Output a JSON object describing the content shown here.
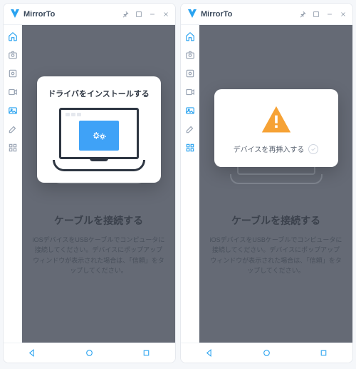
{
  "app": {
    "name": "MirrorTo"
  },
  "windows": [
    {
      "card": {
        "type": "install",
        "title": "ドライバをインストールする"
      },
      "section": {
        "title": "ケーブルを接続する",
        "desc": "iOSデバイスをUSBケーブルでコンピュータに接続してください。デバイスにポップアップウィンドウが表示された場合は、「信頼」をタップしてください。"
      }
    },
    {
      "card": {
        "type": "warn",
        "title": "デバイスを再挿入する"
      },
      "section": {
        "title": "ケーブルを接続する",
        "desc": "iOSデバイスをUSBケーブルでコンピュータに接続してください。デバイスにポップアップウィンドウが表示された場合は、「信頼」をタップしてください。"
      }
    }
  ]
}
